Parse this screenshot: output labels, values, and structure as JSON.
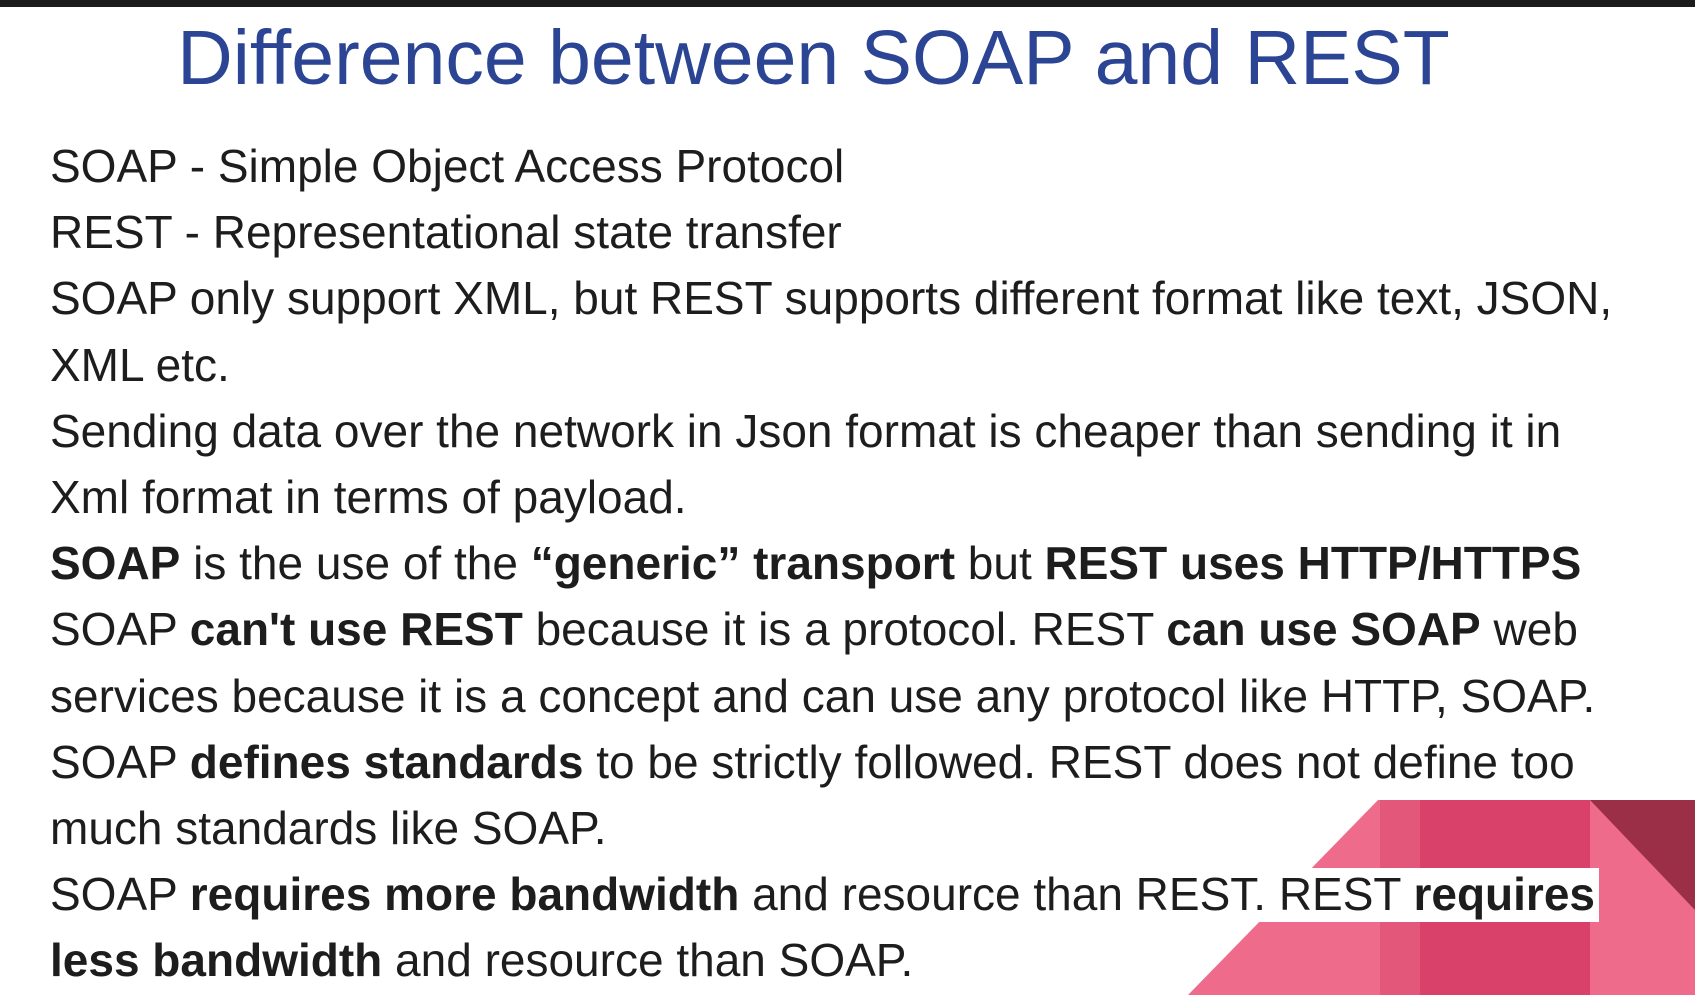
{
  "slide": {
    "title": "Difference between SOAP and REST"
  },
  "points": [
    {
      "segments": [
        {
          "text": "SOAP - Simple Object Access Protocol",
          "bold": false
        }
      ]
    },
    {
      "segments": [
        {
          "text": "REST - Representational state transfer",
          "bold": false
        }
      ]
    },
    {
      "segments": [
        {
          "text": "SOAP only support XML, but REST supports different format like text, JSON,",
          "bold": false
        }
      ]
    },
    {
      "segments": [
        {
          "text": "XML etc.",
          "bold": false
        }
      ]
    },
    {
      "segments": [
        {
          "text": "Sending data over the network in Json format is cheaper than sending it in",
          "bold": false
        }
      ]
    },
    {
      "segments": [
        {
          "text": "Xml format in terms of payload.",
          "bold": false
        }
      ]
    },
    {
      "segments": [
        {
          "text": "SOAP",
          "bold": true
        },
        {
          "text": " is the use of the ",
          "bold": false
        },
        {
          "text": "“generic” transport",
          "bold": true
        },
        {
          "text": " but ",
          "bold": false
        },
        {
          "text": "REST uses HTTP/HTTPS",
          "bold": true
        }
      ]
    },
    {
      "segments": [
        {
          "text": "SOAP ",
          "bold": false
        },
        {
          "text": "can't use REST",
          "bold": true
        },
        {
          "text": " because it is a protocol. REST ",
          "bold": false
        },
        {
          "text": "can use SOAP",
          "bold": true
        },
        {
          "text": " web",
          "bold": false
        }
      ]
    },
    {
      "segments": [
        {
          "text": "services because it is a concept and can use any protocol like HTTP, SOAP.",
          "bold": false
        }
      ]
    },
    {
      "segments": [
        {
          "text": "SOAP ",
          "bold": false
        },
        {
          "text": "defines standards",
          "bold": true
        },
        {
          "text": " to be strictly followed. REST does not define too",
          "bold": false
        }
      ]
    },
    {
      "segments": [
        {
          "text": "much standards like SOAP.",
          "bold": false
        }
      ]
    },
    {
      "highlight": true,
      "segments": [
        {
          "text": "SOAP ",
          "bold": false
        },
        {
          "text": "requires more bandwidth",
          "bold": true
        },
        {
          "text": " and resource than REST. REST ",
          "bold": false
        },
        {
          "text": "requires",
          "bold": true
        }
      ]
    },
    {
      "segments": [
        {
          "text": "less bandwidth",
          "bold": true
        },
        {
          "text": " and resource than SOAP.",
          "bold": false
        }
      ]
    }
  ],
  "colors": {
    "title": "#2b4494",
    "text": "#1d1d1d",
    "accent_pink": "#ef6b8b",
    "accent_pink_mid": "#e3587a",
    "accent_crimson": "#d9406a",
    "accent_maroon": "#9b2f48"
  }
}
